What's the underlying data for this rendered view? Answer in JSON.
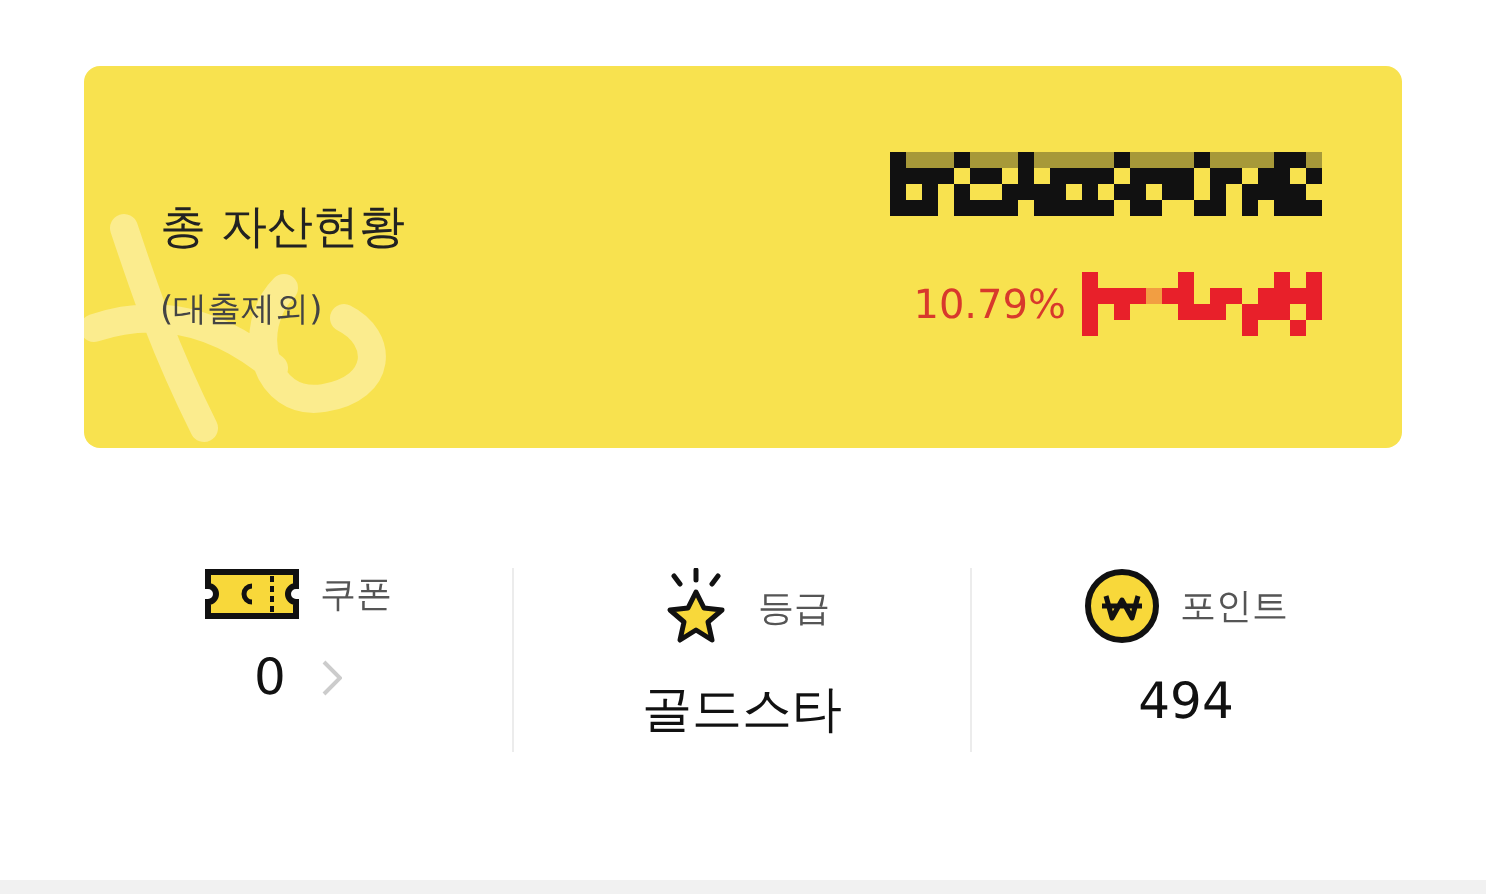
{
  "summary": {
    "title": "총 자산현황",
    "subtitle": "(대출제외)",
    "rate": "10.79%"
  },
  "stats": [
    {
      "kind": "coupon",
      "label": "쿠폰",
      "value": "0",
      "chevron": true
    },
    {
      "kind": "grade",
      "label": "등급",
      "value": "골드스타",
      "chevron": false
    },
    {
      "kind": "point",
      "label": "포인트",
      "value": "494",
      "chevron": false
    }
  ]
}
